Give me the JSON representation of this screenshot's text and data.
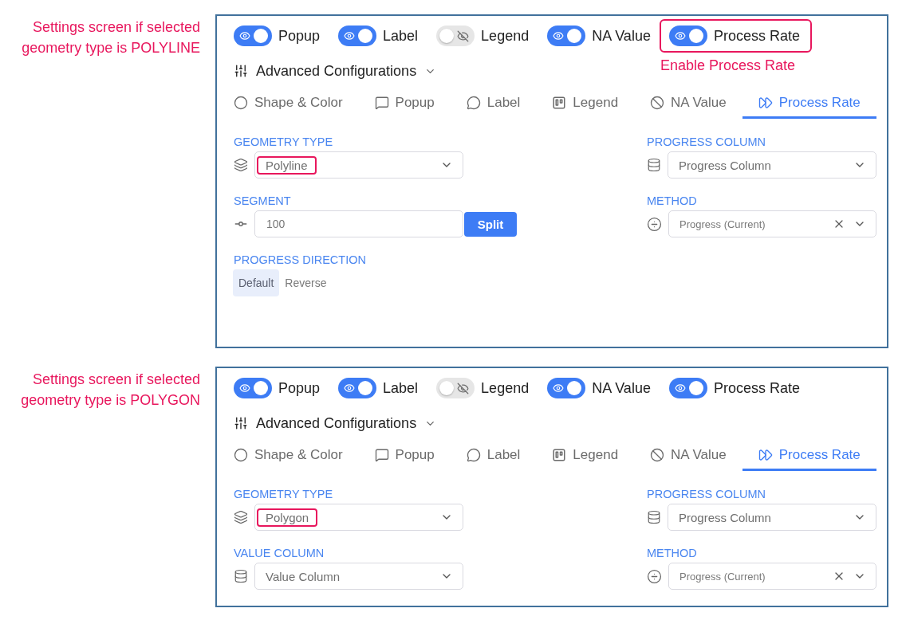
{
  "screens": [
    {
      "caption": "Settings screen if selected geometry type is POLYLINE",
      "toggles": [
        {
          "label": "Popup",
          "on": true,
          "highlighted": false
        },
        {
          "label": "Label",
          "on": true,
          "highlighted": false
        },
        {
          "label": "Legend",
          "on": false,
          "highlighted": false
        },
        {
          "label": "NA Value",
          "on": true,
          "highlighted": false
        },
        {
          "label": "Process Rate",
          "on": true,
          "highlighted": true,
          "note": "Enable Process Rate"
        }
      ],
      "advanced": {
        "label": "Advanced Configurations",
        "expanded": true
      },
      "tabs": [
        {
          "label": "Shape & Color",
          "selected": false
        },
        {
          "label": "Popup",
          "selected": false
        },
        {
          "label": "Label",
          "selected": false
        },
        {
          "label": "Legend",
          "selected": false
        },
        {
          "label": "NA Value",
          "selected": false
        },
        {
          "label": "Process Rate",
          "selected": true
        }
      ],
      "left_fields": [
        {
          "kind": "geometry",
          "label": "GEOMETRY TYPE",
          "value": "Polyline",
          "highlighted": true
        },
        {
          "kind": "segment",
          "label": "SEGMENT",
          "value": "100",
          "button": "Split"
        },
        {
          "kind": "direction",
          "label": "PROGRESS DIRECTION",
          "options": [
            {
              "label": "Default",
              "selected": true
            },
            {
              "label": "Reverse",
              "selected": false
            }
          ]
        }
      ],
      "right_fields": [
        {
          "kind": "column",
          "label": "PROGRESS COLUMN",
          "placeholder": "Progress Column"
        },
        {
          "kind": "method",
          "label": "METHOD",
          "value": "Progress (Current)"
        }
      ]
    },
    {
      "caption": "Settings screen if selected geometry type is POLYGON",
      "toggles": [
        {
          "label": "Popup",
          "on": true,
          "highlighted": false
        },
        {
          "label": "Label",
          "on": true,
          "highlighted": false
        },
        {
          "label": "Legend",
          "on": false,
          "highlighted": false
        },
        {
          "label": "NA Value",
          "on": true,
          "highlighted": false
        },
        {
          "label": "Process Rate",
          "on": true,
          "highlighted": false
        }
      ],
      "advanced": {
        "label": "Advanced Configurations",
        "expanded": true
      },
      "tabs": [
        {
          "label": "Shape & Color",
          "selected": false
        },
        {
          "label": "Popup",
          "selected": false
        },
        {
          "label": "Label",
          "selected": false
        },
        {
          "label": "Legend",
          "selected": false
        },
        {
          "label": "NA Value",
          "selected": false
        },
        {
          "label": "Process Rate",
          "selected": true
        }
      ],
      "left_fields": [
        {
          "kind": "geometry",
          "label": "GEOMETRY TYPE",
          "value": "Polygon",
          "highlighted": true
        },
        {
          "kind": "column",
          "label": "VALUE COLUMN",
          "placeholder": "Value Column"
        }
      ],
      "right_fields": [
        {
          "kind": "column",
          "label": "PROGRESS COLUMN",
          "placeholder": "Progress Column"
        },
        {
          "kind": "method",
          "label": "METHOD",
          "value": "Progress (Current)"
        }
      ]
    }
  ]
}
